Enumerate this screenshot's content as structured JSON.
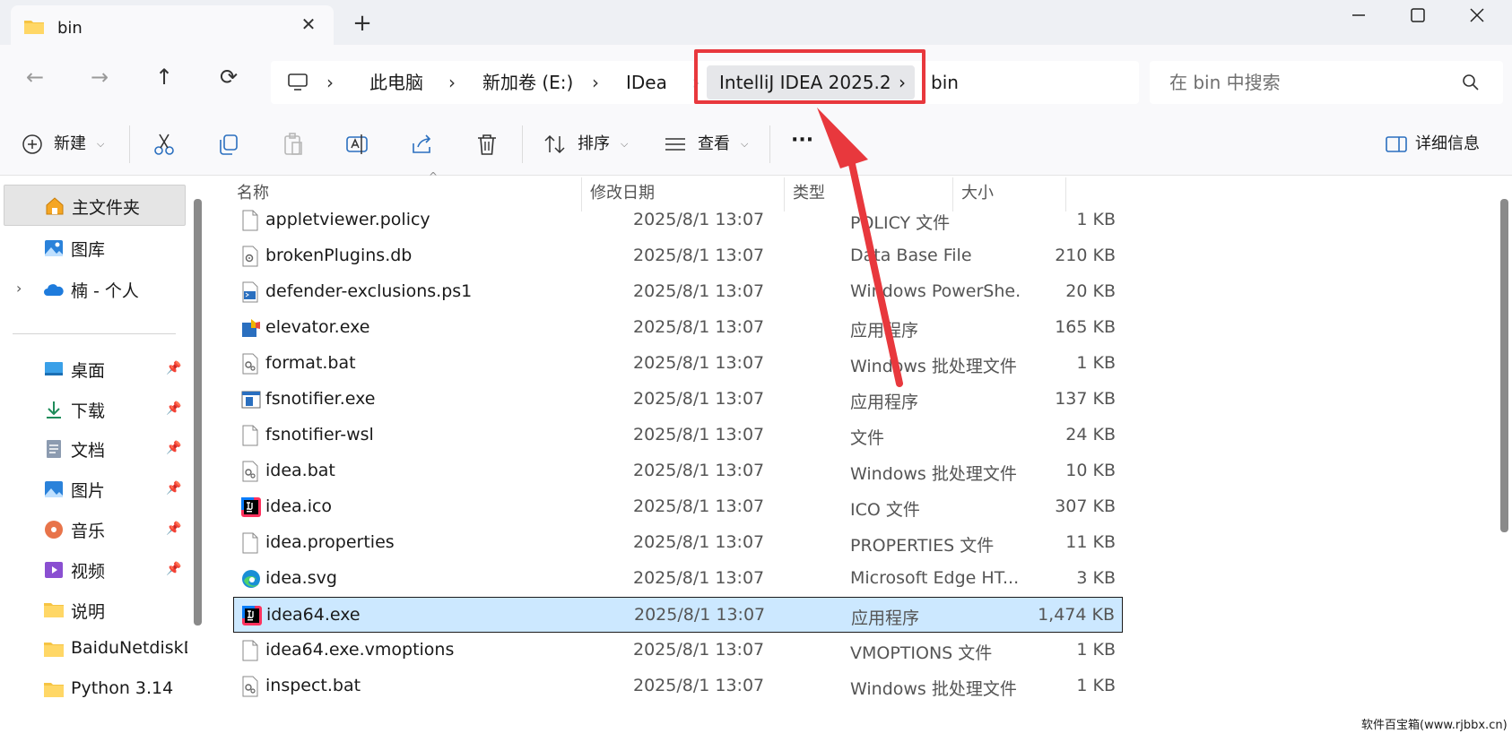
{
  "window": {
    "tab_title": "bin"
  },
  "nav": {
    "breadcrumb": [
      {
        "label": "此电脑"
      },
      {
        "label": "新加卷 (E:)"
      },
      {
        "label": "IDea"
      },
      {
        "label": "IntelliJ IDEA 2025.2"
      },
      {
        "label": "bin"
      }
    ],
    "search_placeholder": "在 bin 中搜索"
  },
  "toolbar": {
    "new_label": "新建",
    "sort_label": "排序",
    "view_label": "查看",
    "more_label": "···",
    "details_label": "详细信息"
  },
  "sidebar": {
    "items": [
      {
        "label": "主文件夹",
        "icon": "home-icon"
      },
      {
        "label": "图库",
        "icon": "gallery-icon"
      },
      {
        "label": "楠 - 个人",
        "icon": "onedrive-icon"
      },
      {
        "label": "桌面",
        "icon": "desktop-icon"
      },
      {
        "label": "下载",
        "icon": "download-icon"
      },
      {
        "label": "文档",
        "icon": "documents-icon"
      },
      {
        "label": "图片",
        "icon": "pictures-icon"
      },
      {
        "label": "音乐",
        "icon": "music-icon"
      },
      {
        "label": "视频",
        "icon": "videos-icon"
      },
      {
        "label": "说明",
        "icon": "folder-icon"
      },
      {
        "label": "BaiduNetdiskD",
        "icon": "folder-icon"
      },
      {
        "label": "Python 3.14",
        "icon": "folder-icon"
      }
    ]
  },
  "list": {
    "columns": {
      "name": "名称",
      "date": "修改日期",
      "type": "类型",
      "size": "大小"
    },
    "rows": [
      {
        "name": "appletviewer.policy",
        "date": "2025/8/1 13:07",
        "type": "POLICY 文件",
        "size": "1 KB",
        "icon": "file-icon"
      },
      {
        "name": "brokenPlugins.db",
        "date": "2025/8/1 13:07",
        "type": "Data Base File",
        "size": "210 KB",
        "icon": "settings-file-icon"
      },
      {
        "name": "defender-exclusions.ps1",
        "date": "2025/8/1 13:07",
        "type": "Windows PowerShe...",
        "size": "20 KB",
        "icon": "powershell-file-icon"
      },
      {
        "name": "elevator.exe",
        "date": "2025/8/1 13:07",
        "type": "应用程序",
        "size": "165 KB",
        "icon": "elevator-app-icon"
      },
      {
        "name": "format.bat",
        "date": "2025/8/1 13:07",
        "type": "Windows 批处理文件",
        "size": "1 KB",
        "icon": "batch-file-icon"
      },
      {
        "name": "fsnotifier.exe",
        "date": "2025/8/1 13:07",
        "type": "应用程序",
        "size": "137 KB",
        "icon": "app-window-icon"
      },
      {
        "name": "fsnotifier-wsl",
        "date": "2025/8/1 13:07",
        "type": "文件",
        "size": "24 KB",
        "icon": "file-icon"
      },
      {
        "name": "idea.bat",
        "date": "2025/8/1 13:07",
        "type": "Windows 批处理文件",
        "size": "10 KB",
        "icon": "batch-file-icon"
      },
      {
        "name": "idea.ico",
        "date": "2025/8/1 13:07",
        "type": "ICO 文件",
        "size": "307 KB",
        "icon": "intellij-icon"
      },
      {
        "name": "idea.properties",
        "date": "2025/8/1 13:07",
        "type": "PROPERTIES 文件",
        "size": "11 KB",
        "icon": "file-icon"
      },
      {
        "name": "idea.svg",
        "date": "2025/8/1 13:07",
        "type": "Microsoft Edge HT...",
        "size": "3 KB",
        "icon": "edge-icon"
      },
      {
        "name": "idea64.exe",
        "date": "2025/8/1 13:07",
        "type": "应用程序",
        "size": "1,474 KB",
        "icon": "intellij-icon",
        "selected": true
      },
      {
        "name": "idea64.exe.vmoptions",
        "date": "2025/8/1 13:07",
        "type": "VMOPTIONS 文件",
        "size": "1 KB",
        "icon": "file-icon"
      },
      {
        "name": "inspect.bat",
        "date": "2025/8/1 13:07",
        "type": "Windows 批处理文件",
        "size": "1 KB",
        "icon": "batch-file-icon"
      }
    ]
  },
  "colors": {
    "highlight_red": "#e8383d",
    "selection_bg": "#cce8ff"
  },
  "watermark": "软件百宝箱(www.rjbbx.cn)"
}
